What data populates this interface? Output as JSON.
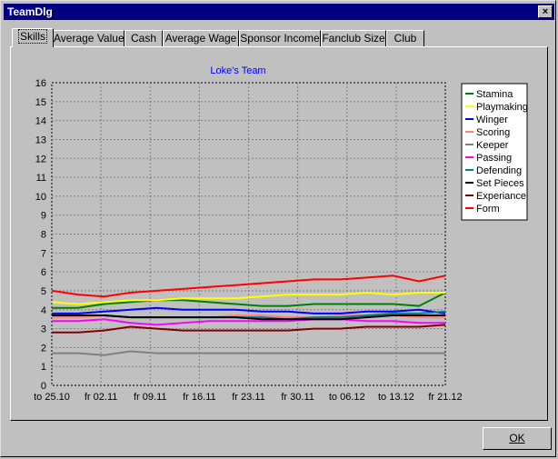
{
  "window": {
    "title": "TeamDlg"
  },
  "tabs": [
    {
      "label": "Skills",
      "active": true
    },
    {
      "label": "Average Value"
    },
    {
      "label": "Cash"
    },
    {
      "label": "Average Wage"
    },
    {
      "label": "Sponsor Income"
    },
    {
      "label": "Fanclub Size"
    },
    {
      "label": "Club"
    }
  ],
  "buttons": {
    "ok": "OK",
    "close": "×"
  },
  "chart_data": {
    "type": "line",
    "title": "Loke's Team",
    "ylim": [
      0,
      16
    ],
    "yticks": [
      0,
      1,
      2,
      3,
      4,
      5,
      6,
      7,
      8,
      9,
      10,
      11,
      12,
      13,
      14,
      15,
      16
    ],
    "xticks": [
      "to 25.10",
      "fr 02.11",
      "fr 09.11",
      "fr 16.11",
      "fr 23.11",
      "fr 30.11",
      "to 06.12",
      "to 13.12",
      "fr 21.12"
    ],
    "legend_position": "right",
    "grid": true,
    "series": [
      {
        "name": "Stamina",
        "color": "#008000",
        "values": [
          4.1,
          4.1,
          4.3,
          4.4,
          4.5,
          4.5,
          4.4,
          4.3,
          4.2,
          4.2,
          4.3,
          4.3,
          4.3,
          4.3,
          4.2,
          4.9
        ]
      },
      {
        "name": "Playmaking",
        "color": "#ffff00",
        "values": [
          4.4,
          4.3,
          4.4,
          4.5,
          4.5,
          4.6,
          4.6,
          4.6,
          4.7,
          4.8,
          4.8,
          4.8,
          4.9,
          4.8,
          4.9,
          4.9
        ]
      },
      {
        "name": "Winger",
        "color": "#0000ff",
        "values": [
          3.8,
          3.8,
          3.9,
          4.0,
          4.1,
          4.0,
          4.0,
          4.0,
          3.9,
          3.9,
          3.8,
          3.8,
          3.9,
          3.9,
          4.0,
          3.8
        ]
      },
      {
        "name": "Scoring",
        "color": "#ff8080",
        "values": [
          3.6,
          3.6,
          3.7,
          3.6,
          3.6,
          3.6,
          3.6,
          3.7,
          3.7,
          3.6,
          3.6,
          3.7,
          3.7,
          3.7,
          3.6,
          3.6
        ]
      },
      {
        "name": "Keeper",
        "color": "#808080",
        "values": [
          1.7,
          1.7,
          1.6,
          1.8,
          1.7,
          1.7,
          1.7,
          1.7,
          1.7,
          1.7,
          1.7,
          1.7,
          1.7,
          1.7,
          1.7,
          1.7
        ]
      },
      {
        "name": "Passing",
        "color": "#ff00ff",
        "values": [
          3.4,
          3.4,
          3.5,
          3.3,
          3.2,
          3.3,
          3.4,
          3.4,
          3.4,
          3.4,
          3.5,
          3.5,
          3.4,
          3.4,
          3.3,
          3.3
        ]
      },
      {
        "name": "Defending",
        "color": "#008080",
        "values": [
          3.7,
          3.7,
          3.7,
          3.6,
          3.6,
          3.6,
          3.6,
          3.6,
          3.6,
          3.5,
          3.6,
          3.6,
          3.7,
          3.8,
          3.8,
          3.9
        ]
      },
      {
        "name": "Set Pieces",
        "color": "#000000",
        "values": [
          3.7,
          3.7,
          3.7,
          3.6,
          3.6,
          3.6,
          3.6,
          3.6,
          3.5,
          3.5,
          3.5,
          3.5,
          3.6,
          3.7,
          3.7,
          3.7
        ]
      },
      {
        "name": "Experiance",
        "color": "#800000",
        "values": [
          2.8,
          2.8,
          2.9,
          3.1,
          3.0,
          2.9,
          2.9,
          2.9,
          2.9,
          2.9,
          3.0,
          3.0,
          3.1,
          3.1,
          3.1,
          3.2
        ]
      },
      {
        "name": "Form",
        "color": "#ff0000",
        "values": [
          5.0,
          4.8,
          4.7,
          4.9,
          5.0,
          5.1,
          5.2,
          5.3,
          5.4,
          5.5,
          5.6,
          5.6,
          5.7,
          5.8,
          5.5,
          5.8
        ]
      }
    ]
  }
}
